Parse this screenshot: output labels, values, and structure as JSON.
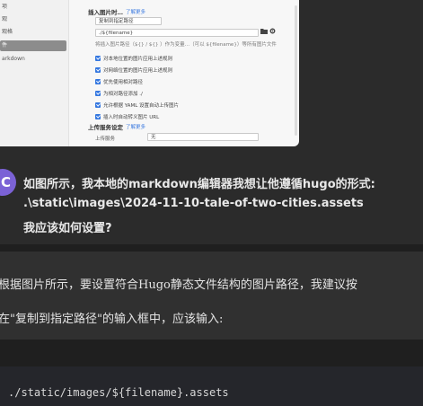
{
  "typora": {
    "sidebar_items": [
      "项",
      "观",
      "观格",
      "件",
      "arkdown"
    ],
    "active_index": 3,
    "insert_image": {
      "title": "插入图片时…",
      "link": "了解更多",
      "select_value": "复制到指定路径",
      "path_value": "./${filename}",
      "folder_icon": "folder-icon",
      "gear_icon": "gear-icon",
      "hint": "将插入图片路径（${} / ${} ）作为变量…（可以 ${filename}）等所有图片文件",
      "checkboxes": [
        "对本地位置的图片应用上述规则",
        "对网络位置的图片应用上述规则",
        "优先使用相对路径",
        "为相对路径添加 ./",
        "允许根据 YAML 设置自动上传图片",
        "插入时自动转义图片 URL"
      ]
    },
    "upload": {
      "title": "上传服务设定",
      "link": "了解更多",
      "label": "上传服务",
      "select_value": "无"
    }
  },
  "question": {
    "avatar_letter": "C",
    "line1": "如图所示，我本地的markdown编辑器我想让他遵循hugo的形式:",
    "line2": ".\\static\\images\\2024-11-10-tale-of-two-cities.assets",
    "line3": "我应该如何设置?"
  },
  "answer": {
    "line1": "根据图片所示，要设置符合Hugo静态文件结构的图片路径，我建议按",
    "line2": "在\"复制到指定路径\"的输入框中，应该输入:",
    "code": "./static/images/${filename}.assets"
  }
}
